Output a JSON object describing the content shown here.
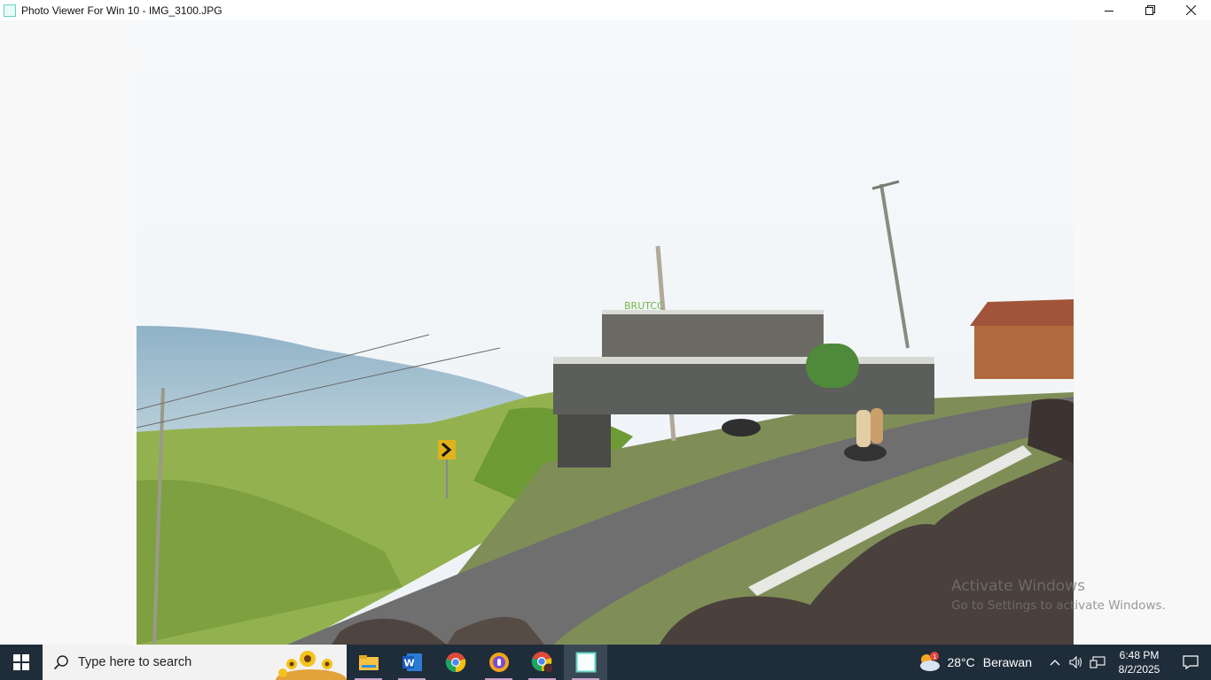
{
  "window": {
    "title": "Photo Viewer For Win 10 - IMG_3100.JPG",
    "controls": [
      "minimize-icon",
      "restore-icon",
      "close-icon"
    ]
  },
  "photo": {
    "signboard_text": "BRUTCC"
  },
  "watermark": {
    "line1": "Activate Windows",
    "line2": "Go to Settings to activate Windows."
  },
  "taskbar": {
    "search_placeholder": "Type here to search",
    "apps": [
      "file-explorer-icon",
      "word-icon",
      "chrome-icon",
      "browser-icon",
      "chrome-profile-icon",
      "photo-viewer-icon"
    ],
    "weather": {
      "badge": "1",
      "temp": "28°C",
      "condition": "Berawan"
    },
    "time": "6:48 PM",
    "date": "8/2/2025"
  },
  "colors": {
    "taskbar": "#1f2c3a",
    "accent_underline": "#c9a3c9"
  }
}
